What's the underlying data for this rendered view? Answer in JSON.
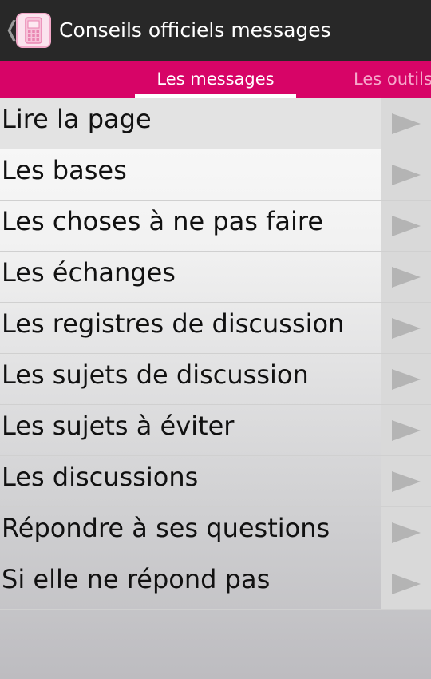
{
  "header": {
    "back_glyph": "❬",
    "title": "Conseils officiels messages",
    "app_icon": "phone-icon"
  },
  "tabs": [
    {
      "label": "Les messages",
      "active": true
    },
    {
      "label": "Les outils",
      "active": false
    }
  ],
  "colors": {
    "action_bar": "#282828",
    "tab_bar": "#d70467",
    "tab_inactive_text": "#f6a8cb",
    "arrow_fill": "#b4b4b4"
  },
  "list": {
    "items": [
      {
        "label": "Lire la page",
        "icon": "play-arrow-icon"
      },
      {
        "label": "Les bases",
        "icon": "play-arrow-icon"
      },
      {
        "label": "Les choses à ne pas faire",
        "icon": "play-arrow-icon"
      },
      {
        "label": "Les échanges",
        "icon": "play-arrow-icon"
      },
      {
        "label": "Les registres de discussion",
        "icon": "play-arrow-icon"
      },
      {
        "label": "Les sujets de discussion",
        "icon": "play-arrow-icon"
      },
      {
        "label": "Les sujets à éviter",
        "icon": "play-arrow-icon"
      },
      {
        "label": "Les discussions",
        "icon": "play-arrow-icon"
      },
      {
        "label": "Répondre à ses questions",
        "icon": "play-arrow-icon"
      },
      {
        "label": "Si elle ne répond pas",
        "icon": "play-arrow-icon"
      }
    ]
  }
}
